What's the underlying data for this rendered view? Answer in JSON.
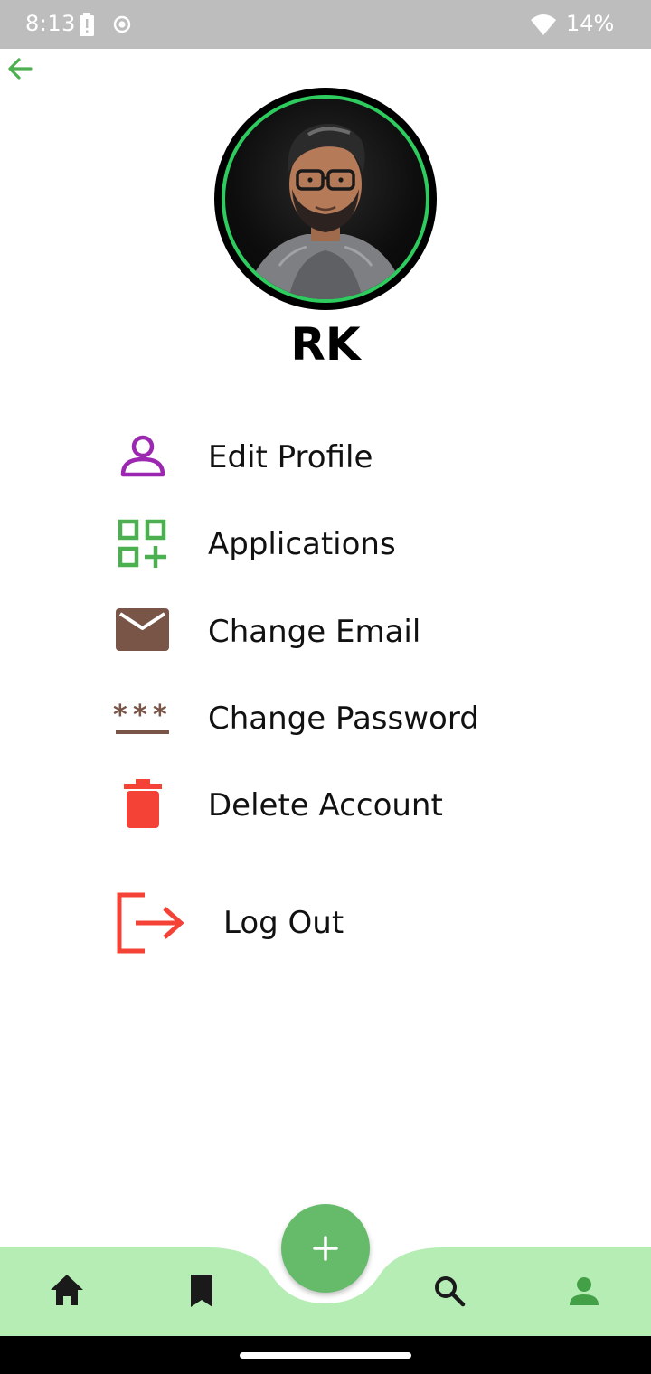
{
  "status_bar": {
    "time": "8:13",
    "battery": "14%",
    "icons": [
      "battery-alert-icon",
      "record-icon",
      "wifi-icon"
    ]
  },
  "header": {
    "back_icon": "arrow-back-icon"
  },
  "profile": {
    "name": "RK",
    "avatar_ring_color": "#2ecc5f"
  },
  "menu": {
    "items": [
      {
        "label": "Edit Profile",
        "icon": "person-outline-icon",
        "color": "#9c27b0"
      },
      {
        "label": "Applications",
        "icon": "apps-add-icon",
        "color": "#4caf50"
      },
      {
        "label": "Change Email",
        "icon": "mail-icon",
        "color": "#795548"
      },
      {
        "label": "Change Password",
        "icon": "password-icon",
        "color": "#795548"
      },
      {
        "label": "Delete Account",
        "icon": "trash-icon",
        "color": "#f44336"
      }
    ],
    "logout": {
      "label": "Log Out",
      "icon": "logout-icon",
      "color": "#f44336"
    }
  },
  "bottom_nav": {
    "background": "#b5edb5",
    "fab_color": "#66bb6a",
    "items": [
      {
        "icon": "home-icon",
        "active": false
      },
      {
        "icon": "bookmark-icon",
        "active": false
      },
      {
        "icon": "add-icon",
        "active": false
      },
      {
        "icon": "search-icon",
        "active": false
      },
      {
        "icon": "person-icon",
        "active": true
      }
    ]
  }
}
